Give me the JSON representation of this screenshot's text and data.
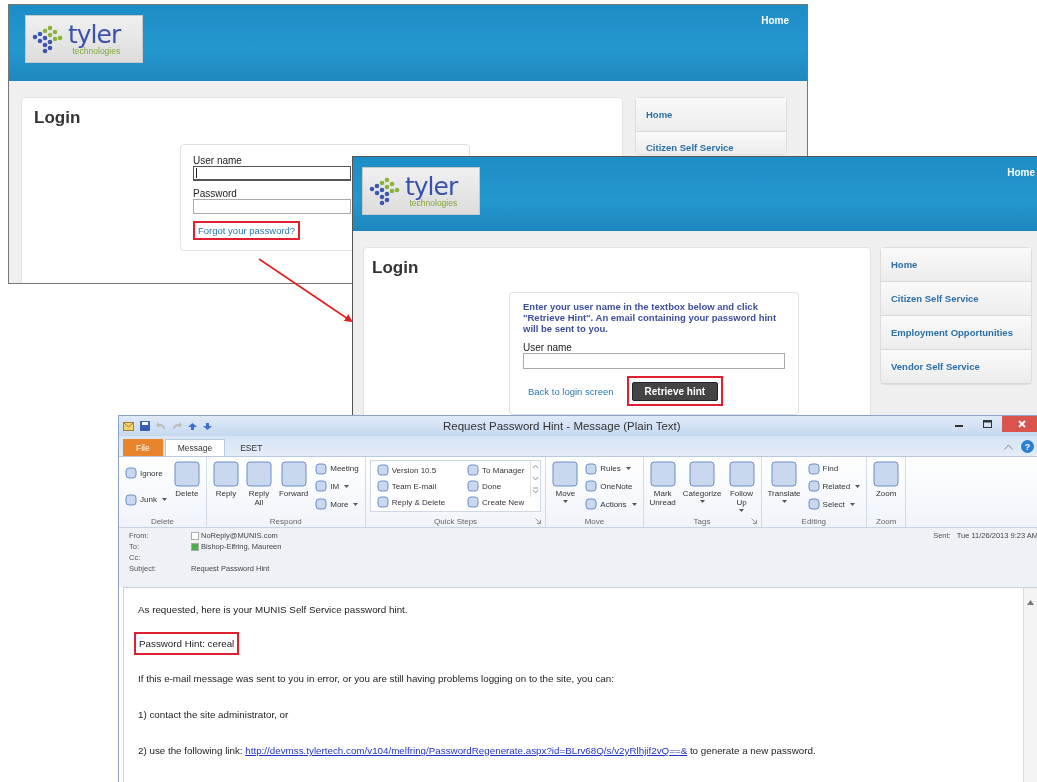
{
  "windows": [
    {
      "kind": "web_page",
      "logo": {
        "wordmark": "tyler",
        "tagline": "technologies"
      },
      "nav_link": "Home",
      "title": "Login",
      "form": {
        "fields": [
          {
            "label": "User name",
            "focused": true
          },
          {
            "label": "Password",
            "focused": false
          }
        ],
        "link": {
          "text": "Forgot your password?",
          "highlighted": true
        }
      },
      "sidebar": [
        {
          "label": "Home"
        },
        {
          "label": "Citizen Self Service"
        }
      ]
    },
    {
      "kind": "web_page",
      "logo": {
        "wordmark": "tyler",
        "tagline": "technologies"
      },
      "nav_link": "Home",
      "title": "Login",
      "form": {
        "instructions": "Enter your user name in the textbox below and click \"Retrieve Hint\". An email containing your password hint will be sent to you.",
        "fields": [
          {
            "label": "User name",
            "focused": false
          }
        ],
        "link": {
          "text": "Back to login screen",
          "highlighted": false
        },
        "button": {
          "text": "Retrieve hint",
          "highlighted": true
        }
      },
      "sidebar": [
        {
          "label": "Home"
        },
        {
          "label": "Citizen Self Service"
        },
        {
          "label": "Employment Opportunities"
        },
        {
          "label": "Vendor Self Service"
        }
      ]
    },
    {
      "kind": "email_window",
      "title": "Request Password Hint - Message (Plain Text)",
      "help": "?",
      "tabs": [
        {
          "label": "File",
          "kind": "file",
          "selected": false
        },
        {
          "label": "Message",
          "kind": "tab",
          "selected": true
        },
        {
          "label": "ESET",
          "kind": "tab",
          "selected": false
        }
      ],
      "ribbon": [
        {
          "label": "Delete",
          "launcher": false,
          "columns": [
            {
              "kind": "stack",
              "items": [
                {
                  "label": "Ignore",
                  "dropdown": false
                },
                {
                  "label": "Junk",
                  "dropdown": true
                }
              ]
            },
            {
              "kind": "large",
              "items": [
                {
                  "label": "Delete",
                  "dropdown": false
                }
              ]
            }
          ]
        },
        {
          "label": "Respond",
          "launcher": false,
          "columns": [
            {
              "kind": "large",
              "items": [
                {
                  "label": "Reply",
                  "dropdown": false
                }
              ]
            },
            {
              "kind": "large",
              "items": [
                {
                  "label": "Reply All",
                  "dropdown": false
                }
              ]
            },
            {
              "kind": "large",
              "items": [
                {
                  "label": "Forward",
                  "dropdown": false
                }
              ]
            },
            {
              "kind": "stack",
              "items": [
                {
                  "label": "Meeting",
                  "dropdown": false
                },
                {
                  "label": "IM",
                  "dropdown": true
                },
                {
                  "label": "More",
                  "dropdown": true
                }
              ]
            }
          ]
        },
        {
          "label": "Quick Steps",
          "launcher": true,
          "columns": [
            {
              "kind": "gallery",
              "items": [
                {
                  "label": "Version 10.5",
                  "dropdown": false
                },
                {
                  "label": "Team E-mail",
                  "dropdown": false
                },
                {
                  "label": "Reply & Delete",
                  "dropdown": false
                },
                {
                  "label": "To Manager",
                  "dropdown": false
                },
                {
                  "label": "Done",
                  "dropdown": false
                },
                {
                  "label": "Create New",
                  "dropdown": false
                }
              ]
            }
          ]
        },
        {
          "label": "Move",
          "launcher": false,
          "columns": [
            {
              "kind": "large",
              "items": [
                {
                  "label": "Move",
                  "dropdown": true
                }
              ]
            },
            {
              "kind": "stack",
              "items": [
                {
                  "label": "Rules",
                  "dropdown": true
                },
                {
                  "label": "OneNote",
                  "dropdown": false
                },
                {
                  "label": "Actions",
                  "dropdown": true
                }
              ]
            }
          ]
        },
        {
          "label": "Tags",
          "launcher": true,
          "columns": [
            {
              "kind": "large",
              "items": [
                {
                  "label": "Mark Unread",
                  "dropdown": false
                }
              ]
            },
            {
              "kind": "large",
              "items": [
                {
                  "label": "Categorize",
                  "dropdown": true
                }
              ]
            },
            {
              "kind": "large",
              "items": [
                {
                  "label": "Follow Up",
                  "dropdown": true
                }
              ]
            }
          ]
        },
        {
          "label": "Editing",
          "launcher": false,
          "columns": [
            {
              "kind": "large",
              "items": [
                {
                  "label": "Translate",
                  "dropdown": true
                }
              ]
            },
            {
              "kind": "stack",
              "items": [
                {
                  "label": "Find",
                  "dropdown": false
                },
                {
                  "label": "Related",
                  "dropdown": true
                },
                {
                  "label": "Select",
                  "dropdown": true
                }
              ]
            }
          ]
        },
        {
          "label": "Zoom",
          "launcher": false,
          "columns": [
            {
              "kind": "large",
              "items": [
                {
                  "label": "Zoom",
                  "dropdown": false
                }
              ]
            }
          ]
        }
      ],
      "header": {
        "fields": [
          {
            "label": "From:",
            "value": "NoReply@MUNIS.com",
            "color": "#ffffff"
          },
          {
            "label": "To:",
            "value": "Bishop-Elfring, Maureen",
            "color": "#4caf50"
          },
          {
            "label": "Cc:"
          },
          {
            "label": "Subject:",
            "value": "Request Password Hint"
          }
        ],
        "sent_label": "Sent:",
        "sent_value": "Tue 11/26/2013 9:23 AM"
      },
      "body": [
        {
          "text": "As requested, here is your MUNIS Self Service password hint.",
          "highlighted": false
        },
        {
          "text": "Password Hint: cereal",
          "highlighted": true
        },
        {
          "text": "If this e-mail message was sent to you in error, or you are still having problems logging on to the site, you can:",
          "highlighted": false
        },
        {
          "text": "1) contact the site administrator, or",
          "highlighted": false
        },
        {
          "text": "2) use the following link: ",
          "link": "http://devmss.tylertech.com/v104/melfring/PasswordRegenerate.aspx?id=BLrv68Q/s/v2yRlhjif2vQ==&",
          "after": " to generate a new password.",
          "highlighted": false
        }
      ]
    }
  ]
}
